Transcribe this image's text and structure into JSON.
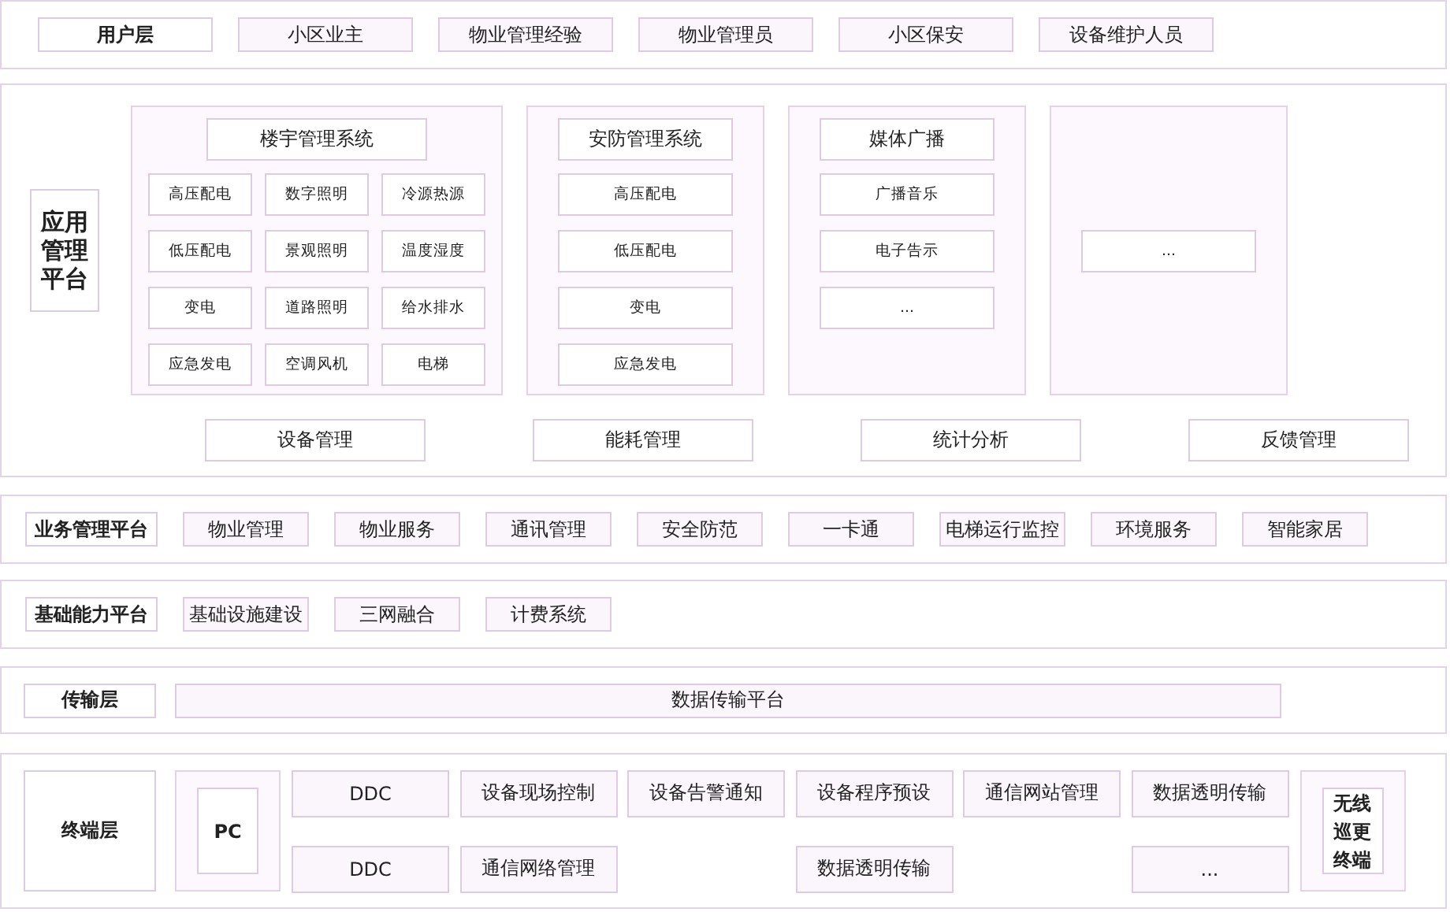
{
  "user_layer": {
    "label": "用户层",
    "items": [
      "小区业主",
      "物业管理经验",
      "物业管理员",
      "小区保安",
      "设备维护人员"
    ]
  },
  "application_platform": {
    "label": "应用管理平台",
    "systems": [
      {
        "kind": "grid",
        "title": "楼宇管理系统",
        "items": [
          "高压配电",
          "数字照明",
          "冷源热源",
          "低压配电",
          "景观照明",
          "温度湿度",
          "变电",
          "道路照明",
          "给水排水",
          "应急发电",
          "空调风机",
          "电梯"
        ]
      },
      {
        "kind": "list",
        "title": "安防管理系统",
        "items": [
          "高压配电",
          "低压配电",
          "变电",
          "应急发电"
        ]
      },
      {
        "kind": "list",
        "title": "媒体广播",
        "items": [
          "广播音乐",
          "电子告示",
          "..."
        ]
      },
      {
        "kind": "centered",
        "items": [
          "..."
        ]
      }
    ],
    "functions": [
      "设备管理",
      "能耗管理",
      "统计分析",
      "反馈管理"
    ]
  },
  "business_platform": {
    "label": "业务管理平台",
    "items": [
      "物业管理",
      "物业服务",
      "通讯管理",
      "安全防范",
      "一卡通",
      "电梯运行监控",
      "环境服务",
      "智能家居"
    ]
  },
  "foundation_platform": {
    "label": "基础能力平台",
    "items": [
      "基础设施建设",
      "三网融合",
      "计费系统"
    ]
  },
  "transport_layer": {
    "label": "传输层",
    "items": [
      "数据传输平台"
    ]
  },
  "terminal_layer": {
    "label": "终端层",
    "left_device": "PC",
    "right_device": "无线巡更终端",
    "rows": [
      [
        {
          "kind": "box",
          "text": "DDC"
        },
        {
          "kind": "box",
          "text": "设备现场控制"
        },
        {
          "kind": "box",
          "text": "设备告警通知"
        },
        {
          "kind": "box",
          "text": "设备程序预设"
        },
        {
          "kind": "box",
          "text": "通信网站管理"
        },
        {
          "kind": "box",
          "text": "数据透明传输"
        }
      ],
      [
        {
          "kind": "box",
          "text": "DDC"
        },
        {
          "kind": "box",
          "text": "通信网络管理"
        },
        {
          "kind": "empty"
        },
        {
          "kind": "box",
          "text": "数据透明传输"
        },
        {
          "kind": "empty"
        },
        {
          "kind": "box",
          "text": "..."
        }
      ]
    ]
  }
}
